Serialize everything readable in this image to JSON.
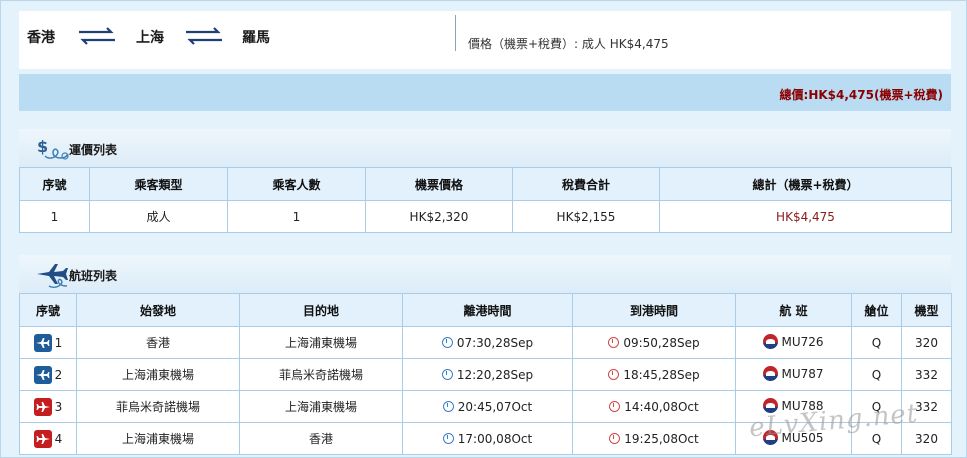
{
  "route": {
    "origin": "香港",
    "via": "上海",
    "destination": "羅馬",
    "price_line": "價格（機票+稅費）: 成人 HK$4,475"
  },
  "total": {
    "text": "總價:HK$4,475(機票+稅費)"
  },
  "fare_section": {
    "title": "運價列表",
    "columns": [
      "序號",
      "乘客類型",
      "乘客人數",
      "機票價格",
      "稅費合計",
      "總計（機票+稅費）"
    ],
    "rows": [
      [
        "1",
        "成人",
        "1",
        "HK$2,320",
        "HK$2,155",
        "HK$4,475"
      ]
    ]
  },
  "flight_section": {
    "title": "航班列表",
    "columns": [
      "序號",
      "始發地",
      "目的地",
      "離港時間",
      "到港時間",
      "航 班",
      "艙位",
      "機型"
    ],
    "rows": [
      {
        "seq": "1",
        "direction": "outbound",
        "from": "香港",
        "to": "上海浦東機場",
        "dep": "07:30,28Sep",
        "arr": "09:50,28Sep",
        "flight": "MU726",
        "cabin": "Q",
        "aircraft": "320"
      },
      {
        "seq": "2",
        "direction": "outbound",
        "from": "上海浦東機場",
        "to": "菲烏米奇諾機場",
        "dep": "12:20,28Sep",
        "arr": "18:45,28Sep",
        "flight": "MU787",
        "cabin": "Q",
        "aircraft": "332"
      },
      {
        "seq": "3",
        "direction": "return",
        "from": "菲烏米奇諾機場",
        "to": "上海浦東機場",
        "dep": "20:45,07Oct",
        "arr": "14:40,08Oct",
        "flight": "MU788",
        "cabin": "Q",
        "aircraft": "332"
      },
      {
        "seq": "4",
        "direction": "return",
        "from": "上海浦東機場",
        "to": "香港",
        "dep": "17:00,08Oct",
        "arr": "19:25,08Oct",
        "flight": "MU505",
        "cabin": "Q",
        "aircraft": "320"
      }
    ]
  },
  "watermark": "eLvXing.net",
  "colors": {
    "background": "#e4f2fb",
    "header_cell": "#e2f1fb",
    "border": "#a9cde6",
    "total_red": "#8b0000",
    "outbound_badge": "#1f5d9a",
    "return_badge": "#c41e1e"
  }
}
